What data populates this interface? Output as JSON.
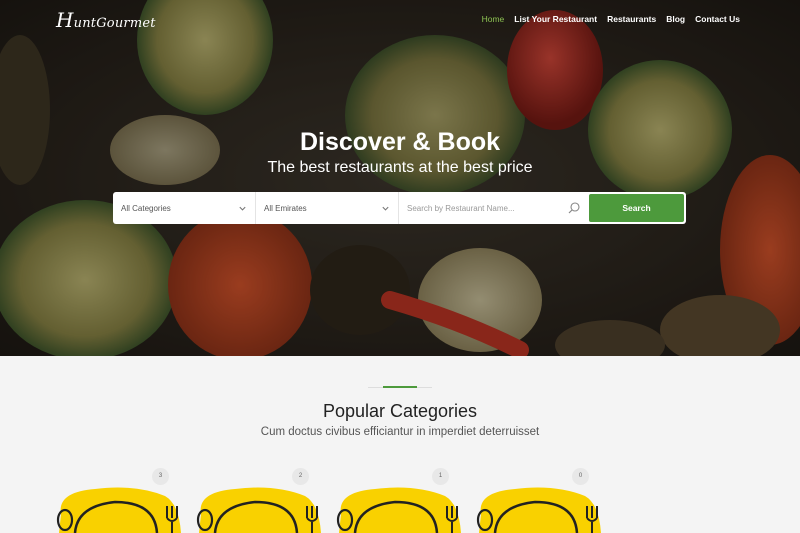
{
  "logo": {
    "text_big": "H",
    "text": "untGourmet"
  },
  "nav": {
    "items": [
      {
        "label": "Home",
        "active": true
      },
      {
        "label": "List Your Restaurant",
        "active": false
      },
      {
        "label": "Restaurants",
        "active": false
      },
      {
        "label": "Blog",
        "active": false
      },
      {
        "label": "Contact Us",
        "active": false
      }
    ]
  },
  "hero": {
    "title": "Discover & Book",
    "subtitle": "The best restaurants at the best price"
  },
  "search": {
    "category_value": "All Categories",
    "emirate_value": "All Emirates",
    "placeholder": "Search by Restaurant Name...",
    "button_label": "Search"
  },
  "categories": {
    "title": "Popular Categories",
    "subtitle": "Cum doctus civibus efficiantur in imperdiet deterruisset",
    "cards": [
      {
        "count": "3"
      },
      {
        "count": "2"
      },
      {
        "count": "1"
      },
      {
        "count": "0"
      }
    ]
  },
  "colors": {
    "accent": "#4d9a3c",
    "nav_active": "#8cc152",
    "plate_yellow": "#f9d100"
  }
}
